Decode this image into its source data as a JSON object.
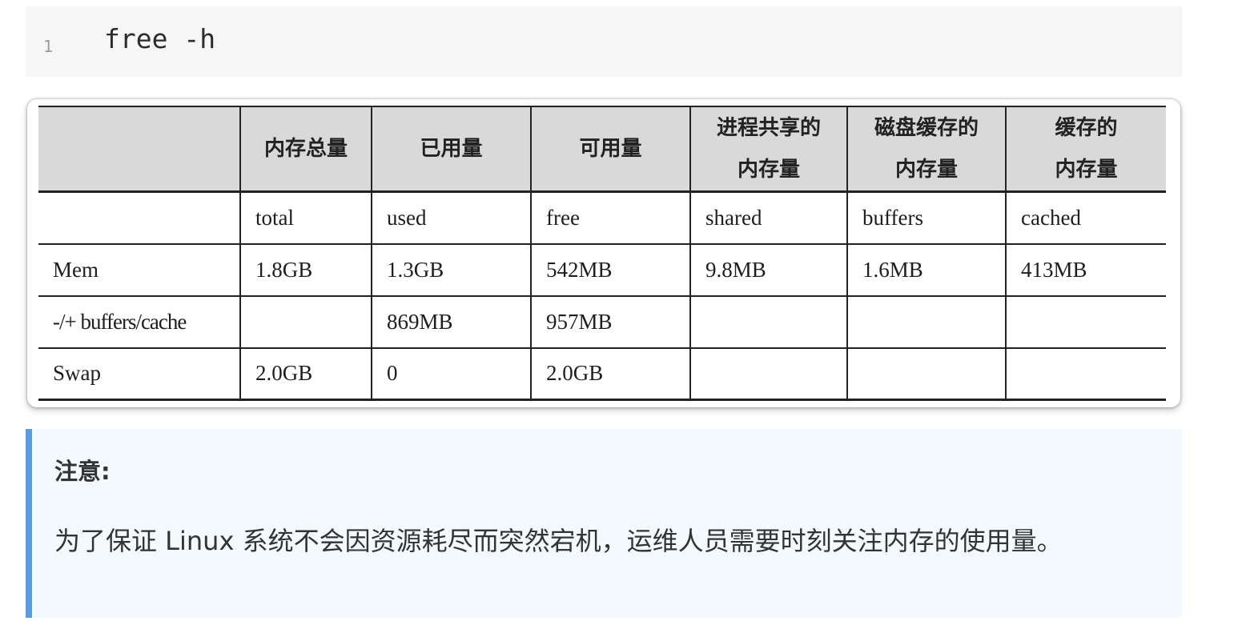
{
  "code": {
    "line_number": "1",
    "text": "free -h"
  },
  "table": {
    "headers": [
      "",
      "内存总量",
      "已用量",
      "可用量",
      "进程共享的内存量",
      "磁盘缓存的内存量",
      "缓存的内存量"
    ],
    "header_lines": [
      [
        ""
      ],
      [
        "内存总量"
      ],
      [
        "已用量"
      ],
      [
        "可用量"
      ],
      [
        "进程共享的",
        "内存量"
      ],
      [
        "磁盘缓存的",
        "内存量"
      ],
      [
        "缓存的",
        "内存量"
      ]
    ],
    "rows": [
      [
        "",
        "total",
        "used",
        "free",
        "shared",
        "buffers",
        "cached"
      ],
      [
        "Mem",
        "1.8GB",
        "1.3GB",
        "542MB",
        "9.8MB",
        "1.6MB",
        "413MB"
      ],
      [
        "-/+ buffers/cache",
        "",
        "869MB",
        "957MB",
        "",
        "",
        ""
      ],
      [
        "Swap",
        "2.0GB",
        "0",
        "2.0GB",
        "",
        "",
        ""
      ]
    ]
  },
  "note": {
    "title": "注意:",
    "body": "为了保证 Linux 系统不会因资源耗尽而突然宕机，运维人员需要时刻关注内存的使用量。"
  },
  "colors": {
    "code_bg": "#f6f6f6",
    "header_bg": "#d9d9d9",
    "note_bg": "#f3f9fd",
    "note_accent": "#5b9be0"
  }
}
